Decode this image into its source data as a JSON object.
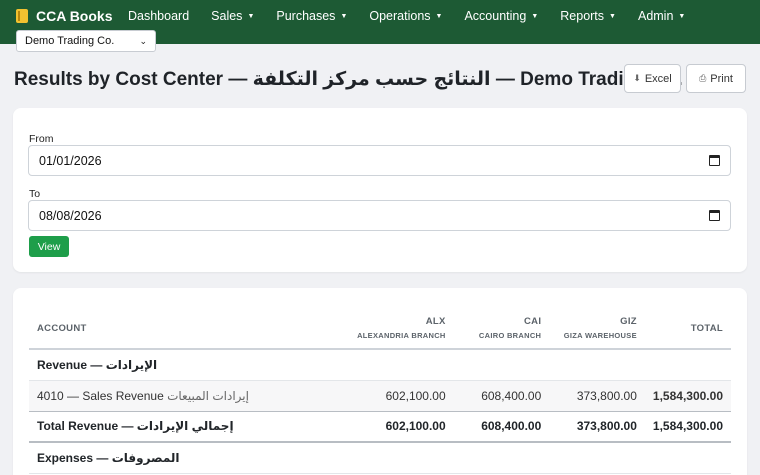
{
  "app": {
    "brand": "CCA Books"
  },
  "nav": {
    "dashboard": "Dashboard",
    "sales": "Sales",
    "purchases": "Purchases",
    "operations": "Operations",
    "accounting": "Accounting",
    "reports": "Reports",
    "admin": "Admin",
    "caret": "▼"
  },
  "company_select": {
    "value": "Demo Trading Co."
  },
  "page": {
    "title": "Results by Cost Center — النتائج حسب مركز التكلفة — Demo Trading Co.",
    "excel_label": "Excel",
    "print_label": "Print"
  },
  "filters": {
    "from_label": "From",
    "from_value": "01/01/2026",
    "to_label": "To",
    "to_value": "08/08/2026",
    "view_label": "View"
  },
  "report": {
    "headers": {
      "account": "Account",
      "alx": "ALX",
      "alx_sub": "Alexandria Branch",
      "cai": "CAI",
      "cai_sub": "Cairo Branch",
      "giz": "GIZ",
      "giz_sub": "Giza Warehouse",
      "total": "Total"
    },
    "revenue_section": "Revenue — الإيرادات",
    "revenue_line": {
      "code_name": "4010 — Sales Revenue",
      "arabic": "إيرادات المبيعات",
      "alx": "602,100.00",
      "cai": "608,400.00",
      "giz": "373,800.00",
      "total": "1,584,300.00"
    },
    "revenue_total": {
      "label": "Total Revenue — إجمالي الإيرادات",
      "alx": "602,100.00",
      "cai": "608,400.00",
      "giz": "373,800.00",
      "total": "1,584,300.00"
    },
    "expenses_section": "Expenses — المصروفات"
  },
  "icons": {
    "brand": "book-icon",
    "excel": "download-icon",
    "print": "printer-icon",
    "calendar": "calendar-icon"
  },
  "colors": {
    "navbar": "#1d5a34",
    "view_button": "#1e9e4a"
  }
}
